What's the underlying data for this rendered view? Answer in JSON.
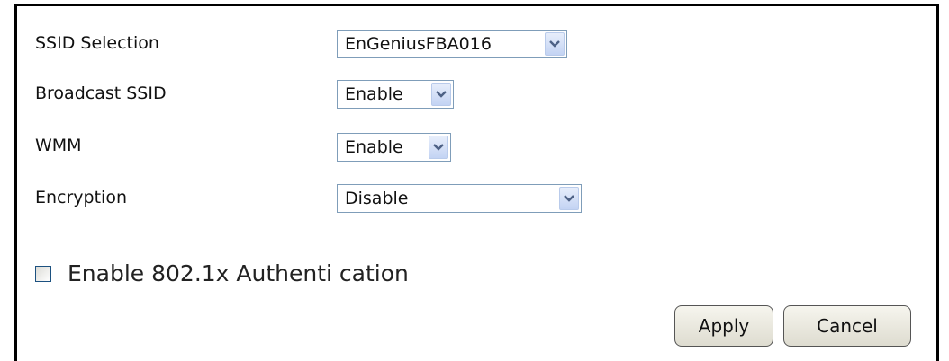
{
  "form": {
    "ssid_selection": {
      "label": "SSID Selection",
      "value": "EnGeniusFBA016"
    },
    "broadcast_ssid": {
      "label": "Broadcast SSID",
      "value": "Enable"
    },
    "wmm": {
      "label": "WMM",
      "value": "Enable"
    },
    "encryption": {
      "label": "Encryption",
      "value": "Disable"
    },
    "auth_8021x": {
      "label": "Enable 802.1x Authenti cation",
      "checked": false
    }
  },
  "buttons": {
    "apply": "Apply",
    "cancel": "Cancel"
  },
  "icons": {
    "dropdown": "chevron-down-icon"
  },
  "colors": {
    "border": "#000000",
    "select_border": "#7f9db9",
    "arrow_bg": "#c3d3f3",
    "arrow_glyph": "#4d6185",
    "button_bg": "#ece9d8"
  }
}
